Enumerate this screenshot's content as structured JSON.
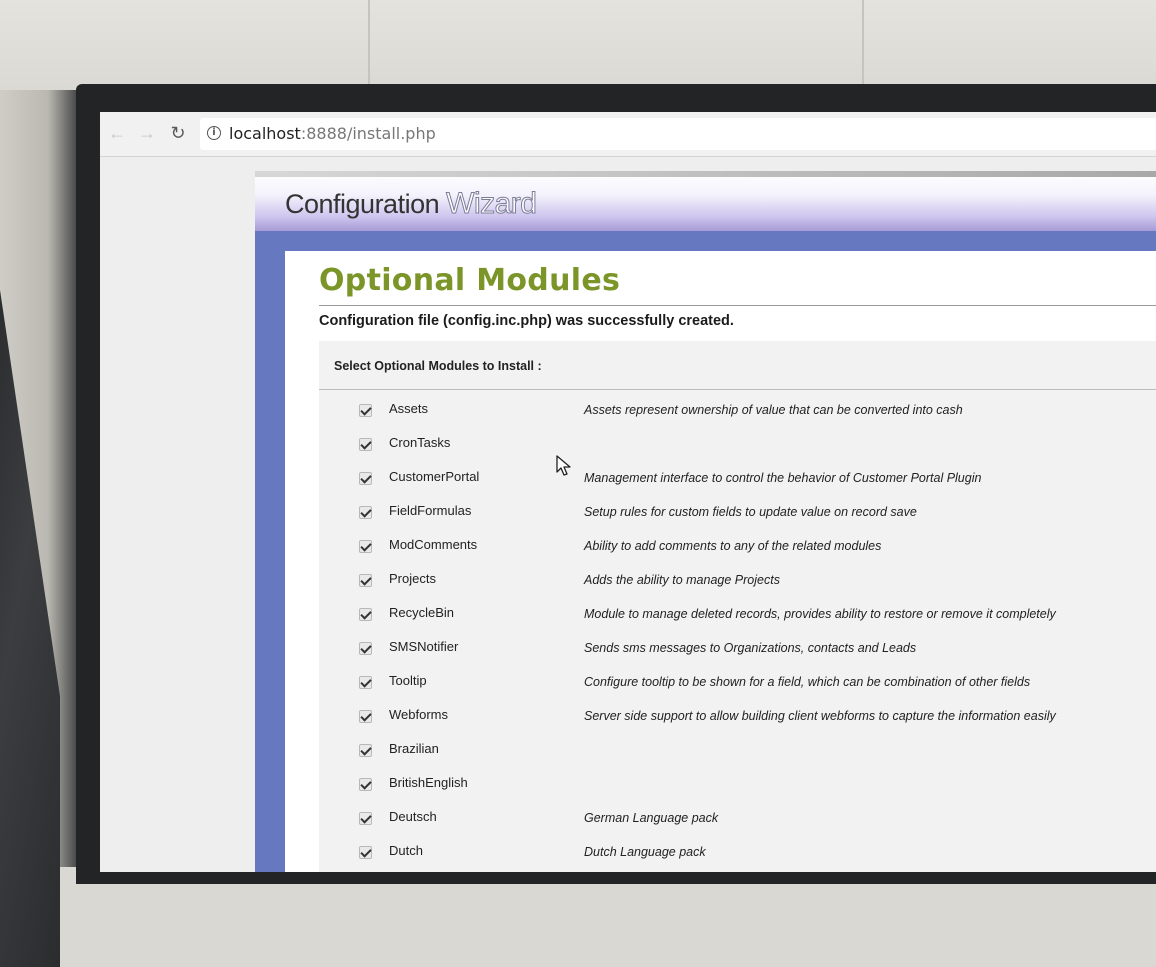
{
  "browser": {
    "url_host": "localhost",
    "url_rest": ":8888/install.php",
    "back_icon": "arrow-left-icon",
    "forward_icon": "arrow-right-icon",
    "reload_icon": "reload-icon",
    "info_icon": "info-icon"
  },
  "wizard": {
    "title_part1": "Configuration",
    "title_part2": "Wizard",
    "page_title": "Optional Modules",
    "success_message": "Configuration file (config.inc.php) was successfully created.",
    "modules_heading": "Select Optional Modules to Install :"
  },
  "modules": [
    {
      "name": "Assets",
      "description": "Assets represent ownership of value that can be converted into cash",
      "checked": true
    },
    {
      "name": "CronTasks",
      "description": "",
      "checked": true
    },
    {
      "name": "CustomerPortal",
      "description": "Management interface to control the behavior of Customer Portal Plugin",
      "checked": true
    },
    {
      "name": "FieldFormulas",
      "description": "Setup rules for custom fields to update value on record save",
      "checked": true
    },
    {
      "name": "ModComments",
      "description": "Ability to add comments to any of the related modules",
      "checked": true
    },
    {
      "name": "Projects",
      "description": "Adds the ability to manage Projects",
      "checked": true
    },
    {
      "name": "RecycleBin",
      "description": "Module to manage deleted records, provides ability to restore or remove it completely",
      "checked": true
    },
    {
      "name": "SMSNotifier",
      "description": "Sends sms messages to Organizations, contacts and Leads",
      "checked": true
    },
    {
      "name": "Tooltip",
      "description": "Configure tooltip to be shown for a field, which can be combination of other fields",
      "checked": true
    },
    {
      "name": "Webforms",
      "description": "Server side support to allow building client webforms to capture the information easily",
      "checked": true
    },
    {
      "name": "Brazilian",
      "description": "",
      "checked": true
    },
    {
      "name": "BritishEnglish",
      "description": "",
      "checked": true
    },
    {
      "name": "Deutsch",
      "description": "German Language pack",
      "checked": true
    },
    {
      "name": "Dutch",
      "description": "Dutch Language pack",
      "checked": true
    }
  ],
  "colors": {
    "page_title": "#7b9528",
    "wizard_frame": "#6679c0"
  }
}
